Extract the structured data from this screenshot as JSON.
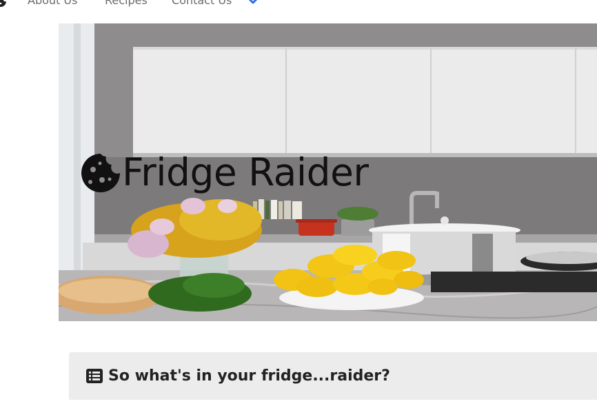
{
  "nav": {
    "brand_icon": "cookie-icon",
    "links": [
      {
        "label": "About Us"
      },
      {
        "label": "Recipes"
      },
      {
        "label": "Contact Us"
      }
    ],
    "dropdown_icon": "chevron-down-icon",
    "colors": {
      "link": "#6b6b6b",
      "chevron": "#2f6fe4"
    }
  },
  "hero": {
    "title": "Fridge Raider",
    "icon": "cookie-icon",
    "image_subject": "kitchen-counter-photo"
  },
  "card": {
    "icon": "list-alt-icon",
    "heading": "So what's in your fridge...raider?",
    "background": "#ececec"
  }
}
